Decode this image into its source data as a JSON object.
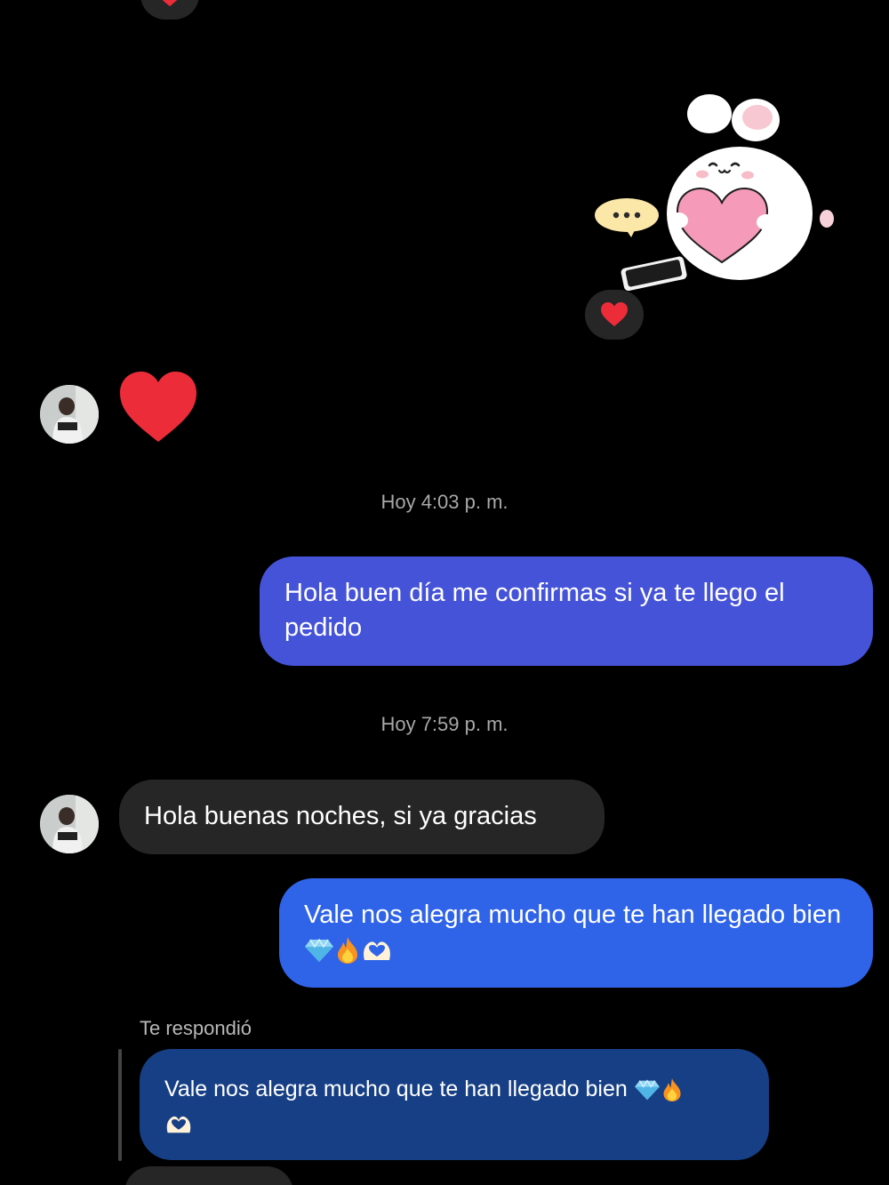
{
  "colors": {
    "background": "#000000",
    "outgoing_bubble_1": "#4553d8",
    "outgoing_bubble_2": "#2f63e8",
    "incoming_bubble": "#262626",
    "reply_bubble": "#173f85",
    "heart": "#ed2c3a"
  },
  "icons": {
    "reaction": "heart-icon",
    "sent_heart": "heart-icon",
    "emojis": [
      "gem-icon",
      "fire-icon",
      "heart-hands-icon"
    ]
  },
  "messages": {
    "timestamp_1": "Hoy 4:03 p. m.",
    "outgoing_1": "Hola buen día me confirmas si ya te llego el pedido",
    "timestamp_2": "Hoy 7:59 p. m.",
    "incoming_1": "Hola buenas noches, si ya gracias",
    "outgoing_2": "Vale nos alegra mucho que te han llegado bien",
    "reply_label": "Te respondió",
    "reply_quote": "Vale nos alegra mucho que te han llegado bien"
  }
}
